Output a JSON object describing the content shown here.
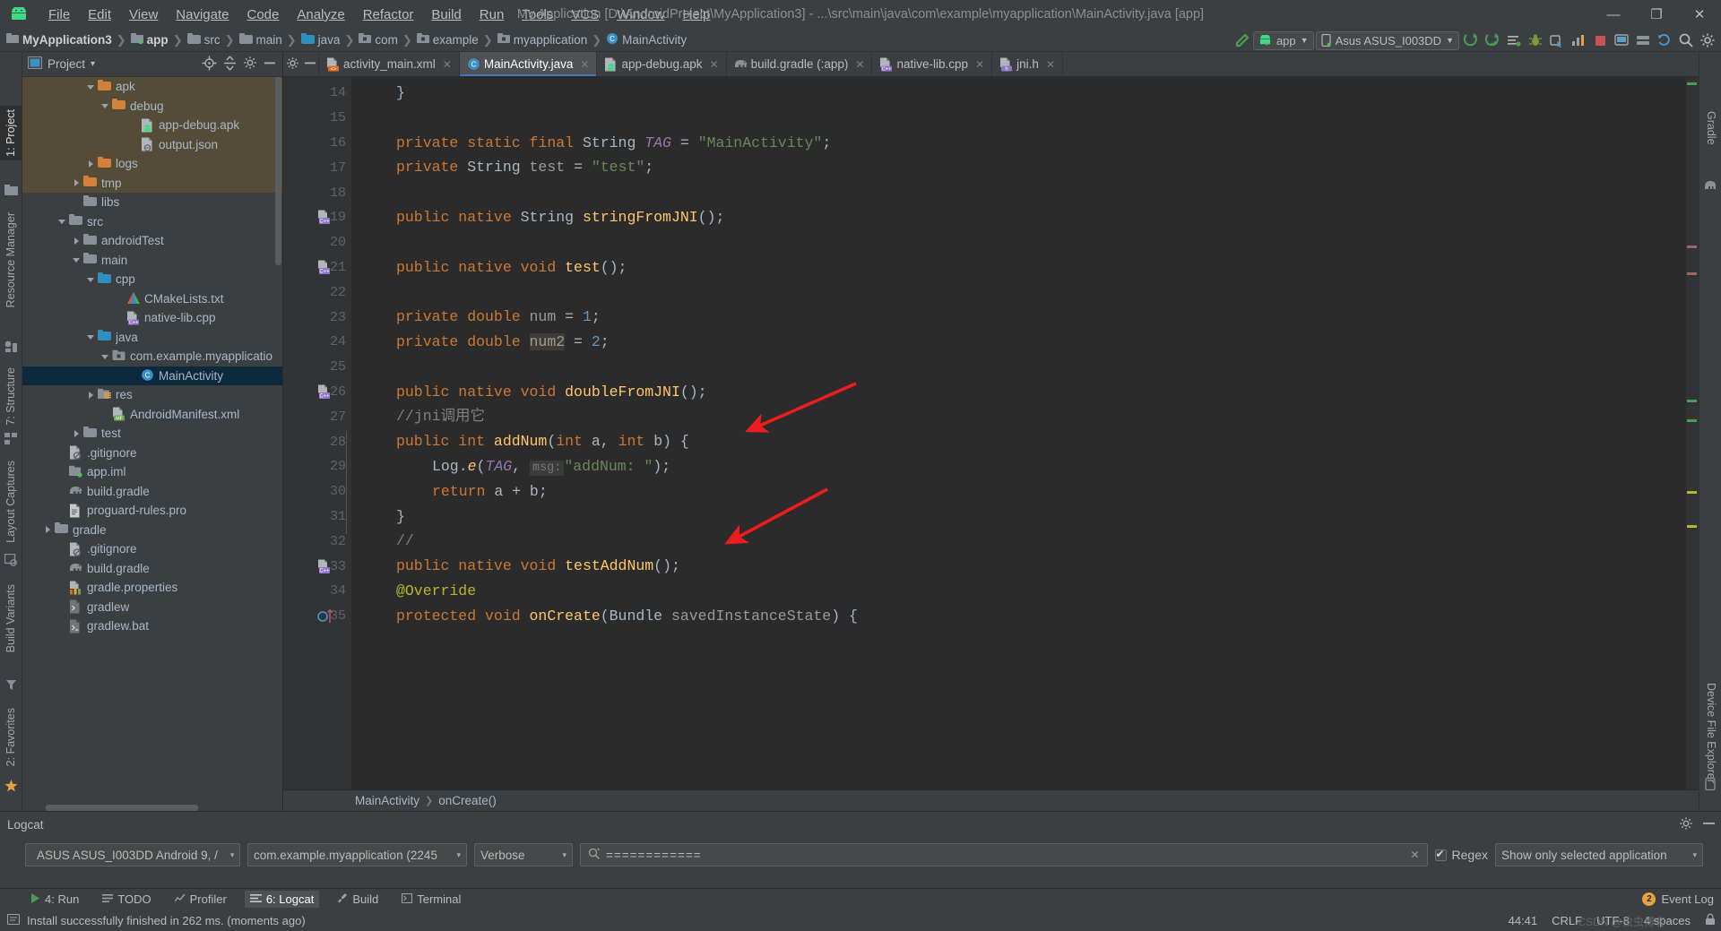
{
  "window": {
    "title": "My Application [D:\\AndroidProject\\MyApplication3] - ...\\src\\main\\java\\com\\example\\myapplication\\MainActivity.java [app]",
    "minimize": "—",
    "maximize": "❐",
    "close": "✕"
  },
  "menu": [
    "File",
    "Edit",
    "View",
    "Navigate",
    "Code",
    "Analyze",
    "Refactor",
    "Build",
    "Run",
    "Tools",
    "VCS",
    "Window",
    "Help"
  ],
  "navbar": {
    "crumbs": [
      {
        "label": "MyApplication3",
        "icon": "module-icon"
      },
      {
        "label": "app",
        "icon": "app-module-icon"
      },
      {
        "label": "src",
        "icon": "folder-icon"
      },
      {
        "label": "main",
        "icon": "folder-icon"
      },
      {
        "label": "java",
        "icon": "source-folder-icon"
      },
      {
        "label": "com",
        "icon": "package-icon"
      },
      {
        "label": "example",
        "icon": "package-icon"
      },
      {
        "label": "myapplication",
        "icon": "package-icon"
      },
      {
        "label": "MainActivity",
        "icon": "class-icon"
      }
    ],
    "separator": "❯",
    "run_config": "app",
    "device": "Asus ASUS_I003DD",
    "icons": [
      "make-project-icon",
      "run-icon",
      "debug-icon",
      "layout-inspector-icon",
      "bug-icon",
      "profiler-icon",
      "attach-debugger-icon",
      "stop-icon",
      "avd-manager-icon",
      "sdk-manager-icon",
      "sync-gradle-icon",
      "search-icon",
      "settings-icon"
    ]
  },
  "left_rail": [
    {
      "label": "1: Project",
      "active": true
    },
    {
      "label": "Resource Manager",
      "active": false
    },
    {
      "label": "7: Structure",
      "active": false
    },
    {
      "label": "Layout Captures",
      "active": false
    },
    {
      "label": "Build Variants",
      "active": false
    },
    {
      "label": "2: Favorites",
      "active": false
    }
  ],
  "right_rail": [
    {
      "label": "Gradle"
    },
    {
      "label": "Device File Explorer"
    }
  ],
  "project_panel": {
    "title": "Project",
    "title_caret": "▾",
    "locate_icon": "locate-icon",
    "collapse_icon": "collapse-all-icon",
    "hide_icon": "hide-icon",
    "settings_icon": "gear-icon",
    "tree": [
      {
        "label": "apk",
        "indent": 4,
        "arrow": "down",
        "icon": "folder-orange",
        "hl": true
      },
      {
        "label": "debug",
        "indent": 5,
        "arrow": "down",
        "icon": "folder-orange",
        "hl": true
      },
      {
        "label": "app-debug.apk",
        "indent": 7,
        "arrow": "none",
        "icon": "apk-file",
        "hl": true
      },
      {
        "label": "output.json",
        "indent": 7,
        "arrow": "none",
        "icon": "json-file",
        "hl": true
      },
      {
        "label": "logs",
        "indent": 4,
        "arrow": "right",
        "icon": "folder-orange",
        "hl": true
      },
      {
        "label": "tmp",
        "indent": 3,
        "arrow": "right",
        "icon": "folder-orange",
        "hl": true
      },
      {
        "label": "libs",
        "indent": 3,
        "arrow": "none",
        "icon": "folder-grey",
        "hl": false
      },
      {
        "label": "src",
        "indent": 2,
        "arrow": "down",
        "icon": "folder-grey",
        "hl": false
      },
      {
        "label": "androidTest",
        "indent": 3,
        "arrow": "right",
        "icon": "folder-grey",
        "hl": false
      },
      {
        "label": "main",
        "indent": 3,
        "arrow": "down",
        "icon": "folder-grey",
        "hl": false
      },
      {
        "label": "cpp",
        "indent": 4,
        "arrow": "down",
        "icon": "folder-blue",
        "hl": false
      },
      {
        "label": "CMakeLists.txt",
        "indent": 6,
        "arrow": "none",
        "icon": "cmake-file",
        "hl": false
      },
      {
        "label": "native-lib.cpp",
        "indent": 6,
        "arrow": "none",
        "icon": "cpp-file",
        "hl": false
      },
      {
        "label": "java",
        "indent": 4,
        "arrow": "down",
        "icon": "folder-blue",
        "hl": false
      },
      {
        "label": "com.example.myapplicatio",
        "indent": 5,
        "arrow": "down",
        "icon": "package-icon",
        "hl": false
      },
      {
        "label": "MainActivity",
        "indent": 7,
        "arrow": "none",
        "icon": "class-icon",
        "hl": false,
        "selected": true
      },
      {
        "label": "res",
        "indent": 4,
        "arrow": "right",
        "icon": "res-folder",
        "hl": false
      },
      {
        "label": "AndroidManifest.xml",
        "indent": 5,
        "arrow": "none",
        "icon": "manifest-file",
        "hl": false
      },
      {
        "label": "test",
        "indent": 3,
        "arrow": "right",
        "icon": "folder-grey",
        "hl": false
      },
      {
        "label": ".gitignore",
        "indent": 2,
        "arrow": "none",
        "icon": "gitignore-file",
        "hl": false
      },
      {
        "label": "app.iml",
        "indent": 2,
        "arrow": "none",
        "icon": "iml-file",
        "hl": false
      },
      {
        "label": "build.gradle",
        "indent": 2,
        "arrow": "none",
        "icon": "gradle-file",
        "hl": false
      },
      {
        "label": "proguard-rules.pro",
        "indent": 2,
        "arrow": "none",
        "icon": "pro-file",
        "hl": false
      },
      {
        "label": "gradle",
        "indent": 1,
        "arrow": "right",
        "icon": "folder-grey",
        "hl": false
      },
      {
        "label": ".gitignore",
        "indent": 2,
        "arrow": "none",
        "icon": "gitignore-file",
        "hl": false
      },
      {
        "label": "build.gradle",
        "indent": 2,
        "arrow": "none",
        "icon": "gradle-file",
        "hl": false
      },
      {
        "label": "gradle.properties",
        "indent": 2,
        "arrow": "none",
        "icon": "properties-file",
        "hl": false
      },
      {
        "label": "gradlew",
        "indent": 2,
        "arrow": "none",
        "icon": "script-file",
        "hl": false
      },
      {
        "label": "gradlew.bat",
        "indent": 2,
        "arrow": "none",
        "icon": "bat-file",
        "hl": false
      }
    ]
  },
  "editor": {
    "tabs": [
      {
        "label": "activity_main.xml",
        "icon": "xml-file",
        "active": false
      },
      {
        "label": "MainActivity.java",
        "icon": "class-icon",
        "active": true
      },
      {
        "label": "app-debug.apk",
        "icon": "apk-file",
        "active": false
      },
      {
        "label": "build.gradle (:app)",
        "icon": "gradle-file",
        "active": false
      },
      {
        "label": "native-lib.cpp",
        "icon": "cpp-file",
        "active": false
      },
      {
        "label": "jni.h",
        "icon": "header-file",
        "active": false
      }
    ],
    "tab_close": "✕",
    "first_line": 14,
    "lines": [
      {
        "n": 14,
        "gutter": "",
        "fold": "end"
      },
      {
        "n": 15,
        "gutter": ""
      },
      {
        "n": 16,
        "gutter": ""
      },
      {
        "n": 17,
        "gutter": ""
      },
      {
        "n": 18,
        "gutter": ""
      },
      {
        "n": 19,
        "gutter": "cpp-marker"
      },
      {
        "n": 20,
        "gutter": ""
      },
      {
        "n": 21,
        "gutter": "cpp-marker"
      },
      {
        "n": 22,
        "gutter": ""
      },
      {
        "n": 23,
        "gutter": ""
      },
      {
        "n": 24,
        "gutter": ""
      },
      {
        "n": 25,
        "gutter": ""
      },
      {
        "n": 26,
        "gutter": "cpp-marker"
      },
      {
        "n": 27,
        "gutter": ""
      },
      {
        "n": 28,
        "gutter": "",
        "fold": "start"
      },
      {
        "n": 29,
        "gutter": ""
      },
      {
        "n": 30,
        "gutter": ""
      },
      {
        "n": 31,
        "gutter": "",
        "fold": "end"
      },
      {
        "n": 32,
        "gutter": ""
      },
      {
        "n": 33,
        "gutter": "cpp-marker"
      },
      {
        "n": 34,
        "gutter": ""
      },
      {
        "n": 35,
        "gutter": "override-marker",
        "fold": "start"
      }
    ],
    "breadcrumb_bottom": [
      "MainActivity",
      "onCreate()"
    ],
    "breadcrumb_sep": "❯"
  },
  "logcat": {
    "title": "Logcat",
    "gear_icon": "gear-icon",
    "minimize_icon": "minimize-icon",
    "device": "ASUS ASUS_I003DD Android 9, /",
    "process": "com.example.myapplication (2245",
    "process_bold": "myapplication",
    "level": "Verbose",
    "search_value": "============",
    "search_placeholder": "",
    "clear_icon": "✕",
    "regex_label": "Regex",
    "regex_checked": true,
    "filter": "Show only selected application",
    "caret": "▾"
  },
  "bottom_tabs": [
    {
      "label": "4: Run",
      "icon": "run-icon",
      "active": false
    },
    {
      "label": "TODO",
      "icon": "todo-icon",
      "active": false
    },
    {
      "label": "Profiler",
      "icon": "profiler-icon",
      "active": false
    },
    {
      "label": "6: Logcat",
      "icon": "logcat-icon",
      "active": true
    },
    {
      "label": "Build",
      "icon": "build-icon",
      "active": false
    },
    {
      "label": "Terminal",
      "icon": "terminal-icon",
      "active": false
    }
  ],
  "bottom_right": {
    "label": "Event Log",
    "icon": "event-log-icon",
    "badge": "2"
  },
  "statusbar": {
    "message": "Install successfully finished in 262 ms. (moments ago)",
    "icon": "info-icon",
    "caret_pos": "44:41",
    "line_sep": "CRLF",
    "encoding": "UTF-8",
    "indent": "4 spaces",
    "lock_icon": "lock-icon",
    "watermark": "CSDN @虫虫博客"
  },
  "colors": {
    "bg": "#3c3f41",
    "editor_bg": "#2b2b2b",
    "gutter": "#313335",
    "accent": "#3d7ab8",
    "selected_row": "#0d293e",
    "highlight_row": "#554c38",
    "keyword": "#cc7832",
    "string": "#6a8759",
    "method": "#ffc66d",
    "number": "#6897bb",
    "field": "#9876aa",
    "comment": "#808080",
    "annotation": "#bbb529",
    "arrow_red": "#ee1c1c",
    "green": "#49c157"
  }
}
